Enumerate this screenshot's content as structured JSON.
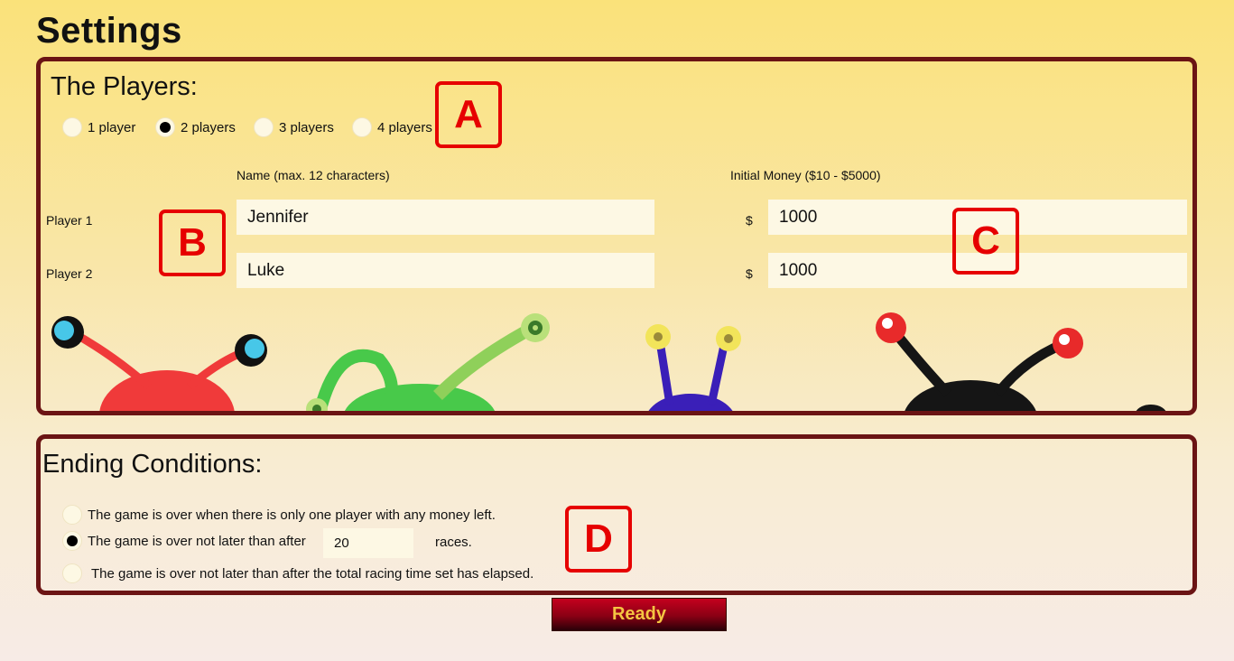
{
  "page": {
    "title": "Settings"
  },
  "players_section": {
    "title": "The Players:",
    "player_count_options": [
      {
        "label": "1 player",
        "selected": false
      },
      {
        "label": "2 players",
        "selected": true
      },
      {
        "label": "3 players",
        "selected": false
      },
      {
        "label": "4 players",
        "selected": false
      }
    ],
    "name_header": "Name (max. 12 characters)",
    "money_header": "Initial Money ($10 - $5000)",
    "currency_symbol": "$",
    "players": [
      {
        "label": "Player 1",
        "name": "Jennifer",
        "money": "1000"
      },
      {
        "label": "Player 2",
        "name": "Luke",
        "money": "1000"
      }
    ],
    "decorative_image": "bug-creatures-illustration"
  },
  "ending_section": {
    "title": "Ending Conditions:",
    "options": [
      {
        "label": "The game is over when there is only one player with any money left.",
        "selected": false
      },
      {
        "label": "The game is over not later than after",
        "selected": true,
        "races_value": "20",
        "suffix": "races."
      },
      {
        "label": "The game is over not later than after the total racing time set has elapsed.",
        "selected": false
      }
    ]
  },
  "annotation_markers": [
    "A",
    "B",
    "C",
    "D"
  ],
  "ready_button": {
    "label": "Ready"
  },
  "colors": {
    "panel_border": "#6b1414",
    "marker": "#e60000",
    "button_text": "#f4c542",
    "field_bg": "#fdf8e4"
  }
}
